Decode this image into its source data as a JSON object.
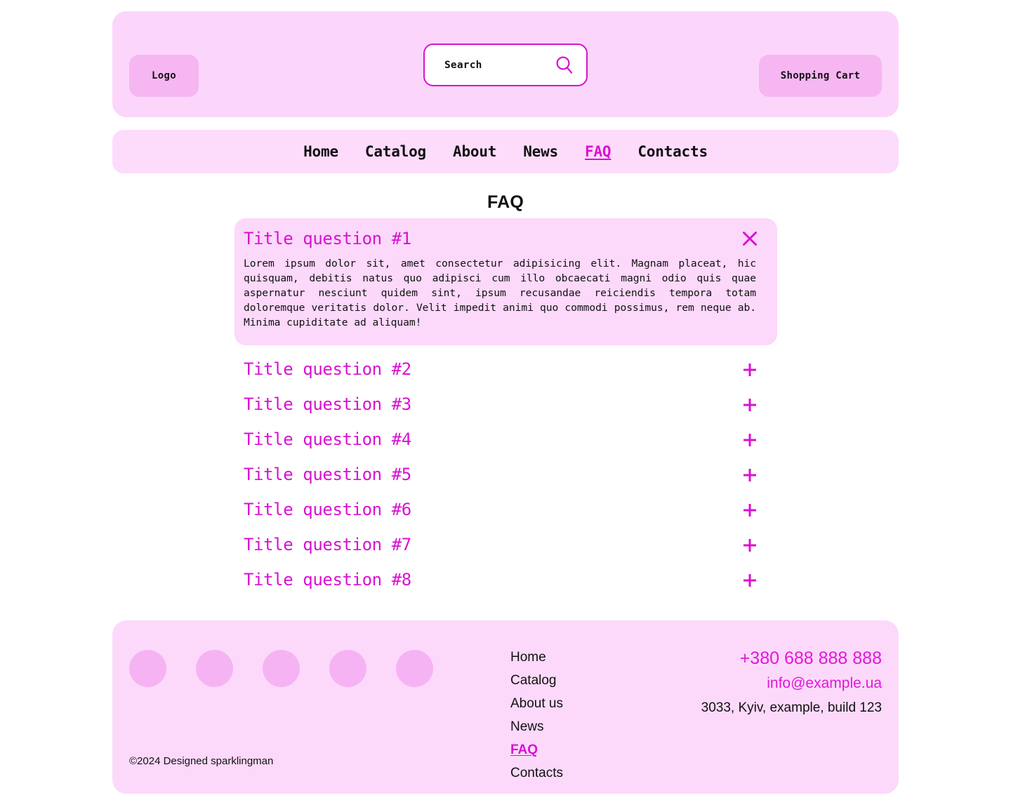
{
  "header": {
    "logo_label": "Logo",
    "search": {
      "placeholder": "Search",
      "value": "",
      "icon": "search-icon"
    },
    "cart_label": "Shopping Cart",
    "background_color": "#fcd5fb",
    "button_color": "#f6b6f2"
  },
  "nav": {
    "items": [
      {
        "label": "Home",
        "active": false
      },
      {
        "label": "Catalog",
        "active": false
      },
      {
        "label": "About",
        "active": false
      },
      {
        "label": "News",
        "active": false
      },
      {
        "label": "FAQ",
        "active": true
      },
      {
        "label": "Contacts",
        "active": false
      }
    ],
    "background_color": "#fddcfb"
  },
  "main": {
    "title": "FAQ",
    "accent_color": "#d911d2",
    "faq": [
      {
        "question": "Title question #1",
        "open": true,
        "toggle_icon": "close-icon",
        "answer": "Lorem ipsum dolor sit, amet consectetur adipisicing elit. Magnam placeat, hic quisquam, debitis natus quo adipisci cum illo obcaecati magni odio quis quae aspernatur nesciunt quidem sint, ipsum recusandae reiciendis tempora totam doloremque veritatis dolor. Velit impedit animi quo commodi possimus, rem neque ab. Minima cupiditate ad aliquam!"
      },
      {
        "question": "Title question #2",
        "open": false,
        "toggle_icon": "plus-icon",
        "answer": ""
      },
      {
        "question": "Title question #3",
        "open": false,
        "toggle_icon": "plus-icon",
        "answer": ""
      },
      {
        "question": "Title question #4",
        "open": false,
        "toggle_icon": "plus-icon",
        "answer": ""
      },
      {
        "question": "Title question #5",
        "open": false,
        "toggle_icon": "plus-icon",
        "answer": ""
      },
      {
        "question": "Title question #6",
        "open": false,
        "toggle_icon": "plus-icon",
        "answer": ""
      },
      {
        "question": "Title question #7",
        "open": false,
        "toggle_icon": "plus-icon",
        "answer": ""
      },
      {
        "question": "Title question #8",
        "open": false,
        "toggle_icon": "plus-icon",
        "answer": ""
      }
    ]
  },
  "footer": {
    "background_color": "#fcd9fb",
    "social_count": 5,
    "social_color": "#f6b3f3",
    "copyright": "©2024 Designed sparklingman",
    "links": [
      {
        "label": "Home",
        "active": false
      },
      {
        "label": "Catalog",
        "active": false
      },
      {
        "label": "About us",
        "active": false
      },
      {
        "label": "News",
        "active": false
      },
      {
        "label": "FAQ",
        "active": true
      },
      {
        "label": "Contacts",
        "active": false
      }
    ],
    "contacts": {
      "phone": "+380 688 888 888",
      "email": "info@example.ua",
      "address": "3033, Kyiv, example, build 123"
    }
  }
}
